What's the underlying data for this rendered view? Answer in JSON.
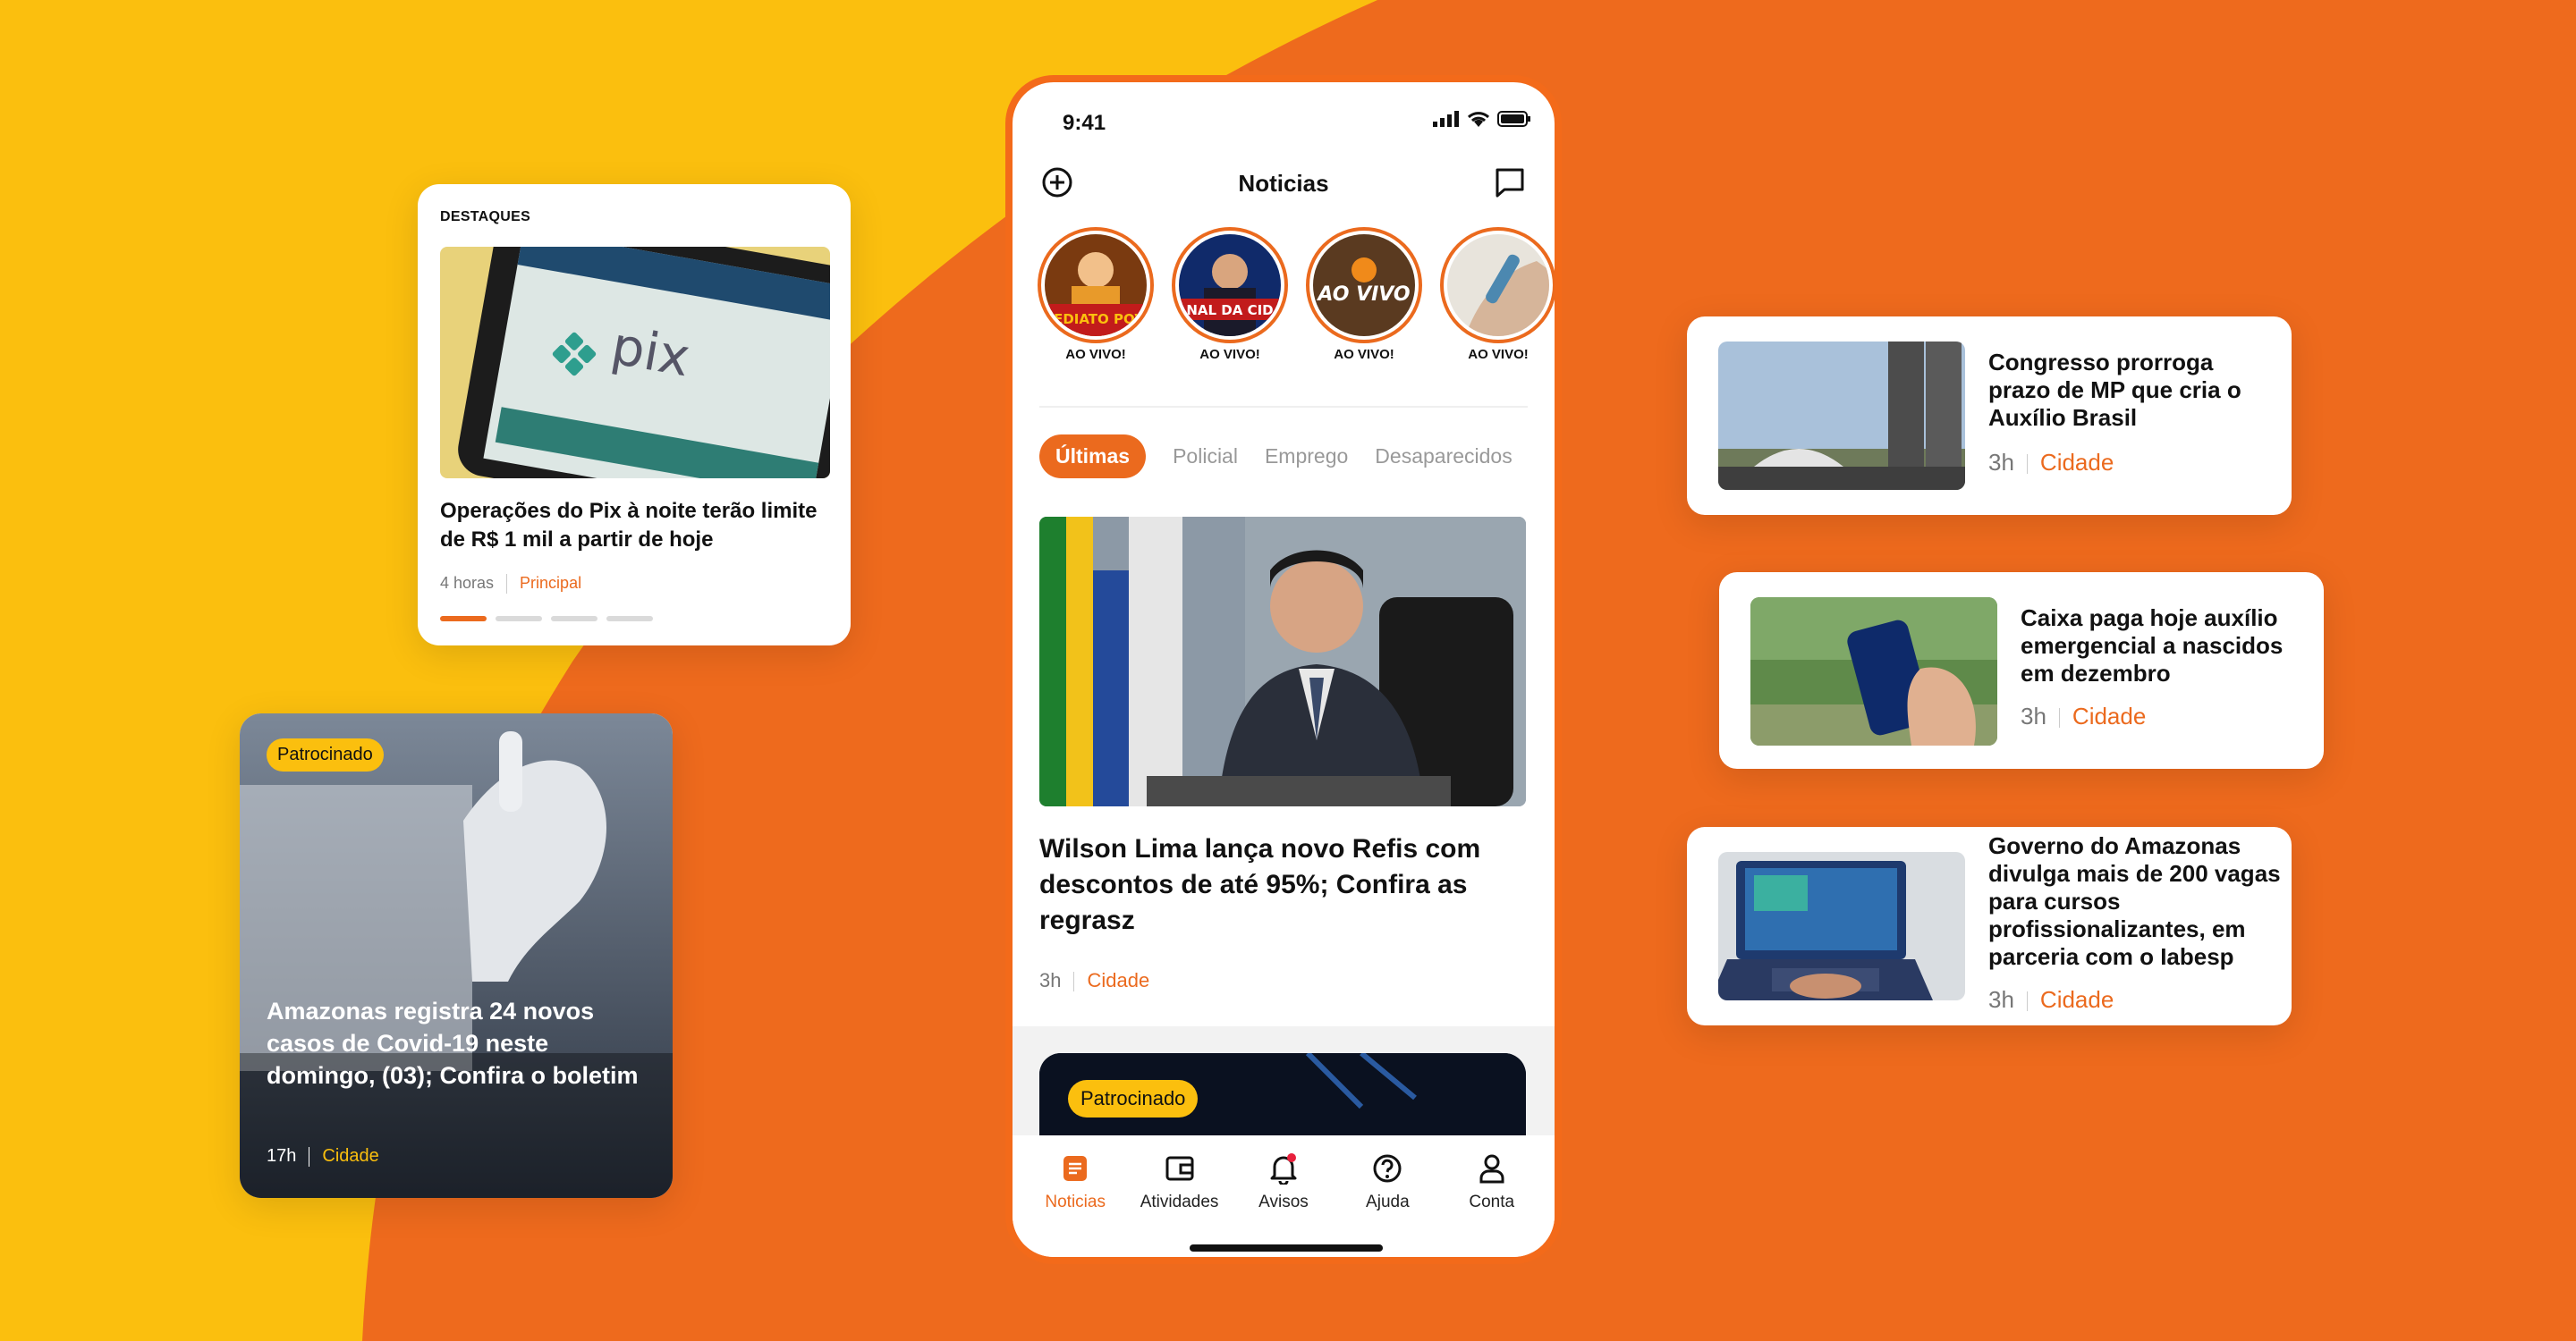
{
  "colors": {
    "accent": "#EB6A1E",
    "yellow": "#FBBF0E",
    "orange_bg": "#EE6A1D"
  },
  "destaques": {
    "label": "DESTAQUES",
    "headline": "Operações do Pix à noite terão limite de R$ 1 mil a partir de hoje",
    "time": "4 horas",
    "category": "Principal",
    "carousel_active_index": 0,
    "carousel_count": 4
  },
  "sponsored_card": {
    "badge": "Patrocinado",
    "headline": "Amazonas registra 24 novos casos de Covid-19 neste domingo, (03); Confira o boletim",
    "time": "17h",
    "category": "Cidade"
  },
  "news_cards": [
    {
      "title": "Congresso prorroga prazo de MP que cria o Auxílio Brasil",
      "time": "3h",
      "category": "Cidade",
      "image": "congress-building-photo"
    },
    {
      "title": "Caixa paga hoje auxílio emergencial a nascidos em dezembro",
      "time": "3h",
      "category": "Cidade",
      "image": "hand-holding-phone-photo"
    },
    {
      "title": "Governo do Amazonas divulga mais de 200 vagas para cursos profissionalizantes, em parceria com o Iabesp",
      "time": "3h",
      "category": "Cidade",
      "image": "laptop-portal-photo"
    }
  ],
  "phone": {
    "status_time": "9:41",
    "header_title": "Noticias",
    "stories": [
      {
        "label": "AO VIVO!",
        "overlay": "IMEDIATO POVO"
      },
      {
        "label": "AO VIVO!",
        "overlay": "NAL DA CID"
      },
      {
        "label": "AO VIVO!",
        "overlay": "AO VIVO"
      },
      {
        "label": "AO VIVO!",
        "overlay": ""
      }
    ],
    "tabs": [
      "Últimas",
      "Policial",
      "Emprego",
      "Desaparecidos"
    ],
    "active_tab": "Últimas",
    "main_article": {
      "title": "Wilson Lima lança novo Refis com descontos de até 95%; Confira as regrasz",
      "time": "3h",
      "category": "Cidade"
    },
    "sponsored_preview_badge": "Patrocinado",
    "bottom_nav": [
      {
        "label": "Noticias",
        "icon": "news-icon",
        "active": true
      },
      {
        "label": "Atividades",
        "icon": "wallet-icon",
        "active": false
      },
      {
        "label": "Avisos",
        "icon": "bell-icon",
        "active": false
      },
      {
        "label": "Ajuda",
        "icon": "help-icon",
        "active": false
      },
      {
        "label": "Conta",
        "icon": "user-icon",
        "active": false
      }
    ]
  }
}
